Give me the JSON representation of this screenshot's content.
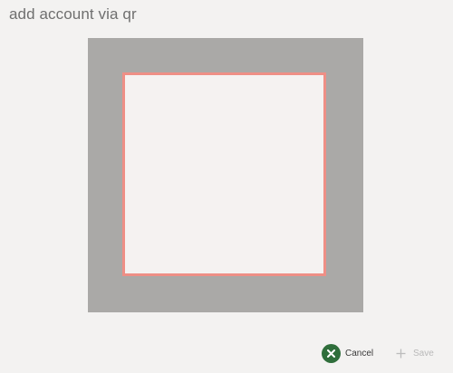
{
  "header": {
    "title": "add account via qr"
  },
  "camera": {
    "frame_color": "#aaa9a7",
    "scan_border_color": "#ee8f86"
  },
  "commands": {
    "cancel": {
      "label": "Cancel",
      "icon": "cancel-icon",
      "enabled": true,
      "color": "#2f6e3b"
    },
    "save": {
      "label": "Save",
      "icon": "add-icon",
      "enabled": false
    }
  }
}
